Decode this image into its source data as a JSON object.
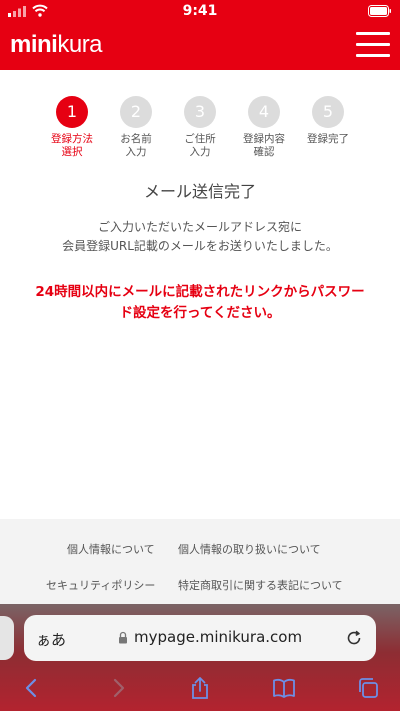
{
  "status": {
    "time": "9:41"
  },
  "header": {
    "logo_bold": "mini",
    "logo_light": "kura"
  },
  "steps": [
    {
      "number": "1",
      "line1": "登録方法",
      "line2": "選択",
      "active": true
    },
    {
      "number": "2",
      "line1": "お名前",
      "line2": "入力",
      "active": false
    },
    {
      "number": "3",
      "line1": "ご住所",
      "line2": "入力",
      "active": false
    },
    {
      "number": "4",
      "line1": "登録内容",
      "line2": "確認",
      "active": false
    },
    {
      "number": "5",
      "line1": "登録完了",
      "line2": "",
      "active": false
    }
  ],
  "content": {
    "title": "メール送信完了",
    "message_line1": "ご入力いただいたメールアドレス宛に",
    "message_line2": "会員登録URL記載のメールをお送りいたしました。",
    "warning_line1": "24時間以内にメールに記載されたリンクからパスワー",
    "warning_line2": "ド設定を行ってください。"
  },
  "footer": {
    "link_privacy": "個人情報について",
    "link_handling": "個人情報の取り扱いについて",
    "link_security": "セキュリティポリシー",
    "link_commerce": "特定商取引に関する表記について"
  },
  "browser": {
    "text_size_label": "ぁあ",
    "url": "mypage.minikura.com"
  },
  "colors": {
    "brand": "#e60012",
    "inactive_step": "#dcdcdc"
  },
  "icons": [
    "signal-icon",
    "wifi-icon",
    "battery-icon",
    "hamburger-menu-icon",
    "lock-icon",
    "reload-icon",
    "back-icon",
    "forward-icon",
    "share-icon",
    "bookmarks-icon",
    "tabs-icon"
  ]
}
